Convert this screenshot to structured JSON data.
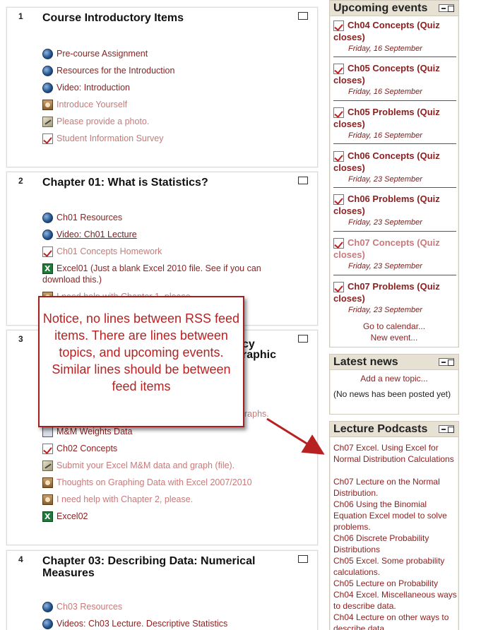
{
  "topics": [
    {
      "number": "1",
      "title": "Course Introductory Items",
      "activities": [
        {
          "icon": "globe-icon",
          "label": "Pre-course Assignment",
          "style": "dark"
        },
        {
          "icon": "globe-icon",
          "label": "Resources for the Introduction",
          "style": "dark"
        },
        {
          "icon": "globe-icon",
          "label": "Video: Introduction",
          "style": "dark"
        },
        {
          "icon": "forum-icon",
          "label": "Introduce Yourself",
          "style": "light"
        },
        {
          "icon": "assignment-icon",
          "label": "Please provide a photo.",
          "style": "light"
        },
        {
          "icon": "quiz-icon",
          "label": "Student Information Survey",
          "style": "light"
        }
      ]
    },
    {
      "number": "2",
      "title": "Chapter 01: What is Statistics?",
      "activities": [
        {
          "icon": "globe-icon",
          "label": "Ch01 Resources",
          "style": "dark"
        },
        {
          "icon": "globe-icon",
          "label": "Video: Ch01 Lecture",
          "style": "underlined"
        },
        {
          "icon": "quiz-icon",
          "label": "Ch01 Concepts Homework",
          "style": "light"
        },
        {
          "icon": "excel-icon",
          "label": "Excel01 (Just a blank Excel 2010 file. See if you can download this.)",
          "style": "dark"
        },
        {
          "icon": "forum-icon",
          "label": "I need help with Chapter 1, please.",
          "style": "light"
        }
      ]
    },
    {
      "number": "3",
      "title_part1": "cy",
      "title_part2": "raphic",
      "activities": [
        {
          "label": "raphs.",
          "style": "light"
        },
        {
          "icon": "file-icon",
          "label": "M&M Weights Data",
          "style": "dark"
        },
        {
          "icon": "quiz-icon",
          "label": "Ch02 Concepts",
          "style": "dark"
        },
        {
          "icon": "assignment-icon",
          "label": "Submit your Excel M&M data and graph (file).",
          "style": "light"
        },
        {
          "icon": "forum-icon",
          "label": "Thoughts on Graphing Data with Excel 2007/2010",
          "style": "light"
        },
        {
          "icon": "forum-icon",
          "label": "I need help with Chapter 2, please.",
          "style": "light"
        },
        {
          "icon": "excel-icon",
          "label": "Excel02",
          "style": "dark"
        }
      ]
    },
    {
      "number": "4",
      "title": "Chapter 03: Describing Data: Numerical Measures",
      "activities": [
        {
          "icon": "globe-icon",
          "label": "Ch03 Resources",
          "style": "light"
        },
        {
          "icon": "globe-icon",
          "label": "Videos: Ch03 Lecture. Descriptive Statistics",
          "style": "dark"
        }
      ]
    }
  ],
  "upcoming_events": {
    "title": "Upcoming events",
    "events": [
      {
        "name": "Ch04 Concepts (Quiz closes)",
        "date": "Friday, 16 September",
        "style": "dark"
      },
      {
        "name": "Ch05 Concepts (Quiz closes)",
        "date": "Friday, 16 September",
        "style": "dark"
      },
      {
        "name": "Ch05 Problems (Quiz closes)",
        "date": "Friday, 16 September",
        "style": "dark"
      },
      {
        "name": "Ch06 Concepts (Quiz closes)",
        "date": "Friday, 23 September",
        "style": "dark"
      },
      {
        "name": "Ch06 Problems (Quiz closes)",
        "date": "Friday, 23 September",
        "style": "dark"
      },
      {
        "name": "Ch07 Concepts (Quiz closes)",
        "date": "Friday, 23 September",
        "style": "light"
      },
      {
        "name": "Ch07 Problems (Quiz closes)",
        "date": "Friday, 23 September",
        "style": "dark"
      }
    ],
    "calendar_link": "Go to calendar...",
    "new_event_link": "New event..."
  },
  "latest_news": {
    "title": "Latest news",
    "add_topic_link": "Add a new topic...",
    "empty_text": "(No news has been posted yet)"
  },
  "lecture_podcasts": {
    "title": "Lecture Podcasts",
    "items": [
      "Ch07 Excel. Using Excel for Normal Distribution Calculations",
      "Ch07 Lecture on the Normal Distribution.",
      "Ch06 Using the Binomial Equation Excel model to solve problems.",
      "Ch06 Discrete Probability Distributions",
      "Ch05 Excel. Some probability calculations.",
      "Ch05 Lecture on Probability",
      "Ch04 Excel. Miscellaneous ways to describe data.",
      "Ch04 Lecture on other ways to describe data."
    ]
  },
  "callout": {
    "text": "Notice, no lines between RSS feed items.  There are lines between topics, and upcoming events.  Similar lines should be between feed items"
  },
  "colors": {
    "link": "#8a1f1f",
    "link_dimmed": "#c87a7a",
    "block_header": "#e6e1d2",
    "callout_border": "#a32020"
  }
}
